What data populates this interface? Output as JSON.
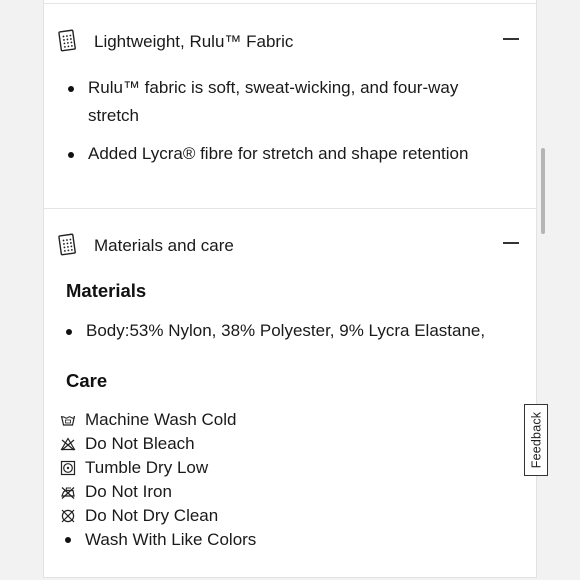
{
  "sections": [
    {
      "title": "Lightweight, Rulu™ Fabric",
      "icon": "fabric-swatch-icon",
      "bullets": [
        "Rulu™ fabric is soft, sweat-wicking, and four-way",
        "stretch",
        "Added Lycra® fibre for stretch and shape retention"
      ]
    },
    {
      "title": "Materials and care",
      "icon": "fabric-swatch-icon",
      "materials_heading": "Materials",
      "materials": [
        "Body:53% Nylon, 38% Polyester, 9% Lycra Elastane,"
      ],
      "care_heading": "Care",
      "care": [
        {
          "label": "Machine Wash Cold",
          "icon": "wash-tub-icon"
        },
        {
          "label": "Do Not Bleach",
          "icon": "no-bleach-icon"
        },
        {
          "label": "Tumble Dry Low",
          "icon": "tumble-dry-icon"
        },
        {
          "label": "Do Not Iron",
          "icon": "no-iron-icon"
        },
        {
          "label": "Do Not Dry Clean",
          "icon": "no-dry-clean-icon"
        },
        {
          "label": "Wash With Like Colors",
          "icon": "bullet"
        }
      ]
    }
  ],
  "feedback_label": "Feedback"
}
